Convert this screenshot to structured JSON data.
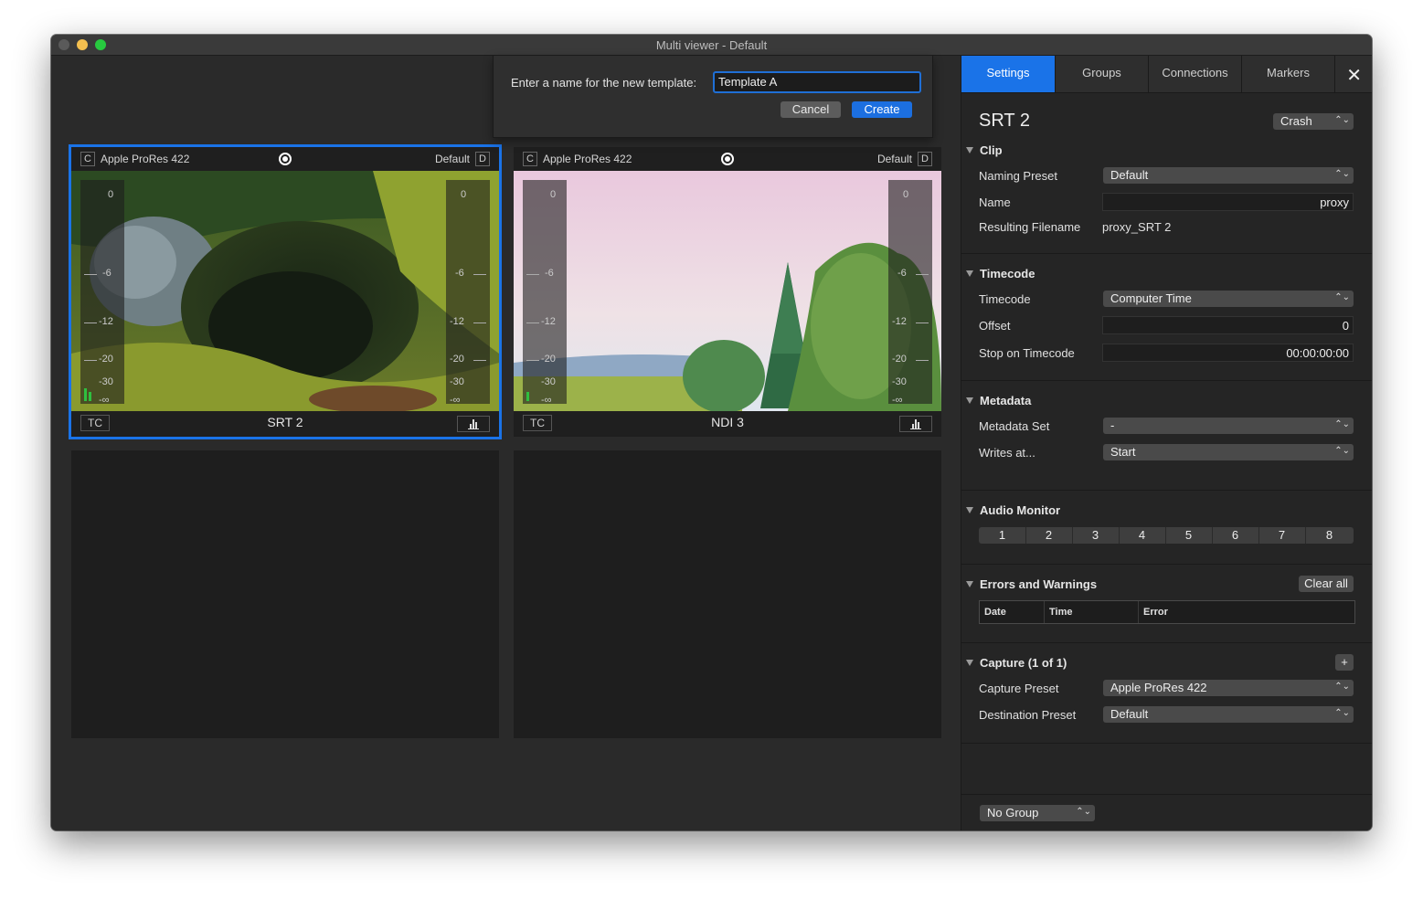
{
  "window": {
    "title": "Multi viewer - Default"
  },
  "dialog": {
    "prompt": "Enter a name for the new template:",
    "input_value": "Template A",
    "cancel_label": "Cancel",
    "create_label": "Create"
  },
  "panes": [
    {
      "codec": "Apple ProRes 422",
      "preset": "Default",
      "c_badge": "C",
      "d_badge": "D",
      "tc": "TC",
      "source": "SRT 2",
      "meter_labels": [
        "0",
        "-6",
        "-12",
        "-20",
        "-30",
        "-∞"
      ]
    },
    {
      "codec": "Apple ProRes 422",
      "preset": "Default",
      "c_badge": "C",
      "d_badge": "D",
      "tc": "TC",
      "source": "NDI 3",
      "meter_labels": [
        "0",
        "-6",
        "-12",
        "-20",
        "-30",
        "-∞"
      ]
    }
  ],
  "sidebar": {
    "tabs": [
      "Settings",
      "Groups",
      "Connections",
      "Markers"
    ],
    "title": "SRT 2",
    "mode": "Crash",
    "clip": {
      "section": "Clip",
      "naming_preset_label": "Naming Preset",
      "naming_preset_value": "Default",
      "name_label": "Name",
      "name_value": "proxy",
      "resulting_label": "Resulting Filename",
      "resulting_value": "proxy_SRT 2"
    },
    "timecode": {
      "section": "Timecode",
      "timecode_label": "Timecode",
      "timecode_value": "Computer Time",
      "offset_label": "Offset",
      "offset_value": "0",
      "stop_label": "Stop on Timecode",
      "stop_value": "00:00:00:00"
    },
    "metadata": {
      "section": "Metadata",
      "set_label": "Metadata Set",
      "set_value": "-",
      "writes_label": "Writes at...",
      "writes_value": "Start"
    },
    "audio": {
      "section": "Audio Monitor",
      "channels": [
        "1",
        "2",
        "3",
        "4",
        "5",
        "6",
        "7",
        "8"
      ]
    },
    "errors": {
      "section": "Errors and Warnings",
      "clear_label": "Clear all",
      "columns": [
        "Date",
        "Time",
        "Error"
      ]
    },
    "capture": {
      "section": "Capture (1 of 1)",
      "add_label": "+",
      "preset_label": "Capture Preset",
      "preset_value": "Apple ProRes 422",
      "dest_label": "Destination Preset",
      "dest_value": "Default"
    },
    "group_value": "No Group"
  },
  "colors": {
    "accent": "#1a73e8",
    "window_bg": "#2b2b2b",
    "panel_bg": "#252525"
  }
}
